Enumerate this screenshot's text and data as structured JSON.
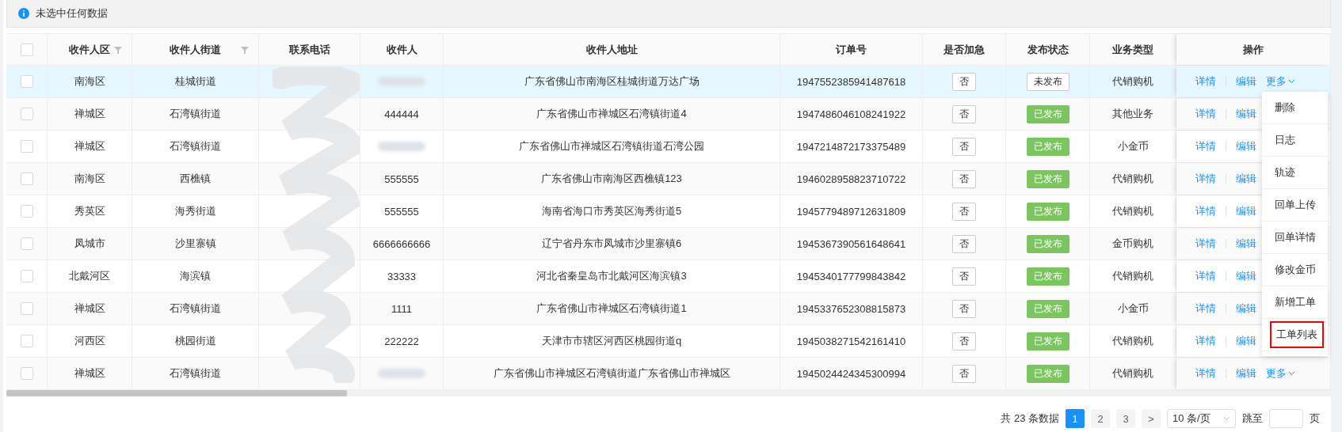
{
  "alert": {
    "text": "未选中任何数据"
  },
  "table": {
    "select_all_checked": false,
    "columns": [
      {
        "label": "收件人区",
        "filter": true
      },
      {
        "label": "收件人街道",
        "filter": true
      },
      {
        "label": "联系电话",
        "filter": false
      },
      {
        "label": "收件人",
        "filter": false
      },
      {
        "label": "收件人地址",
        "filter": false
      },
      {
        "label": "订单号",
        "filter": false
      },
      {
        "label": "是否加急",
        "filter": false
      },
      {
        "label": "发布状态",
        "filter": false
      },
      {
        "label": "业务类型",
        "filter": false
      },
      {
        "label": "操作",
        "filter": false
      }
    ],
    "rows": [
      {
        "highlighted": true,
        "checked": false,
        "district": "南海区",
        "street": "桂城街道",
        "recipient_redacted": true,
        "address": "广东省佛山市南海区桂城街道万达广场",
        "order_no": "1947552385941487618",
        "urgent": "否",
        "status": {
          "label": "未发布",
          "published": false
        },
        "business": "代销购机",
        "actions": [
          "详情",
          "编辑",
          "更多"
        ]
      },
      {
        "highlighted": false,
        "checked": false,
        "district": "禅城区",
        "street": "石湾镇街道",
        "recipient": "444444",
        "address": "广东省佛山市禅城区石湾镇街道4",
        "order_no": "1947486046108241922",
        "urgent": "否",
        "status": {
          "label": "已发布",
          "published": true
        },
        "business": "其他业务",
        "actions": [
          "详情",
          "编辑"
        ]
      },
      {
        "highlighted": false,
        "checked": false,
        "district": "禅城区",
        "street": "石湾镇街道",
        "recipient_redacted": true,
        "address": "广东省佛山市禅城区石湾镇街道石湾公园",
        "order_no": "1947214872173375489",
        "urgent": "否",
        "status": {
          "label": "已发布",
          "published": true
        },
        "business": "小金币",
        "actions": [
          "详情",
          "编辑"
        ]
      },
      {
        "highlighted": false,
        "checked": false,
        "district": "南海区",
        "street": "西樵镇",
        "recipient": "555555",
        "address": "广东省佛山市南海区西樵镇123",
        "order_no": "1946028958823710722",
        "urgent": "否",
        "status": {
          "label": "已发布",
          "published": true
        },
        "business": "代销购机",
        "actions": [
          "详情",
          "编辑"
        ]
      },
      {
        "highlighted": false,
        "checked": false,
        "district": "秀英区",
        "street": "海秀街道",
        "recipient": "555555",
        "address": "海南省海口市秀英区海秀街道5",
        "order_no": "1945779489712631809",
        "urgent": "否",
        "status": {
          "label": "已发布",
          "published": true
        },
        "business": "代销购机",
        "actions": [
          "详情",
          "编辑"
        ]
      },
      {
        "highlighted": false,
        "checked": false,
        "district": "凤城市",
        "street": "沙里寨镇",
        "recipient": "6666666666",
        "address": "辽宁省丹东市凤城市沙里寨镇6",
        "order_no": "1945367390561648641",
        "urgent": "否",
        "status": {
          "label": "已发布",
          "published": true
        },
        "business": "金币购机",
        "actions": [
          "详情",
          "编辑"
        ]
      },
      {
        "highlighted": false,
        "checked": false,
        "district": "北戴河区",
        "street": "海滨镇",
        "recipient": "33333",
        "address": "河北省秦皇岛市北戴河区海滨镇3",
        "order_no": "1945340177799843842",
        "urgent": "否",
        "status": {
          "label": "已发布",
          "published": true
        },
        "business": "代销购机",
        "actions": [
          "详情",
          "编辑"
        ]
      },
      {
        "highlighted": false,
        "checked": false,
        "district": "禅城区",
        "street": "石湾镇街道",
        "recipient": "1111",
        "address": "广东省佛山市禅城区石湾镇街道1",
        "order_no": "1945337652308815873",
        "urgent": "否",
        "status": {
          "label": "已发布",
          "published": true
        },
        "business": "小金币",
        "actions": [
          "详情",
          "编辑"
        ]
      },
      {
        "highlighted": false,
        "checked": false,
        "district": "河西区",
        "street": "桃园街道",
        "recipient": "222222",
        "address": "天津市市辖区河西区桃园街道q",
        "order_no": "1945038271542161410",
        "urgent": "否",
        "status": {
          "label": "已发布",
          "published": true
        },
        "business": "代销购机",
        "actions": [
          "详情",
          "编辑"
        ]
      },
      {
        "highlighted": false,
        "checked": false,
        "district": "禅城区",
        "street": "石湾镇街道",
        "recipient_redacted": true,
        "address": "广东省佛山市禅城区石湾镇街道广东省佛山市禅城区",
        "order_no": "1945024424345300994",
        "urgent": "否",
        "status": {
          "label": "已发布",
          "published": true
        },
        "business": "代销购机",
        "actions": [
          "详情",
          "编辑",
          "更多"
        ]
      }
    ]
  },
  "more_menu": {
    "items": [
      {
        "label": "删除",
        "outlined": false
      },
      {
        "label": "日志",
        "outlined": false
      },
      {
        "label": "轨迹",
        "outlined": false
      },
      {
        "label": "回单上传",
        "outlined": false
      },
      {
        "label": "回单详情",
        "outlined": false
      },
      {
        "label": "修改金币",
        "outlined": false
      },
      {
        "label": "新增工单",
        "outlined": false
      },
      {
        "label": "工单列表",
        "outlined": true
      }
    ]
  },
  "pagination": {
    "total": "共 23 条数据",
    "pages": [
      {
        "label": "1",
        "selected": true
      },
      {
        "label": "2",
        "selected": false
      },
      {
        "label": "3",
        "selected": false
      }
    ],
    "next": ">",
    "page_size": "10 条/页",
    "jump_label": "跳至",
    "jump_suffix": "页"
  }
}
